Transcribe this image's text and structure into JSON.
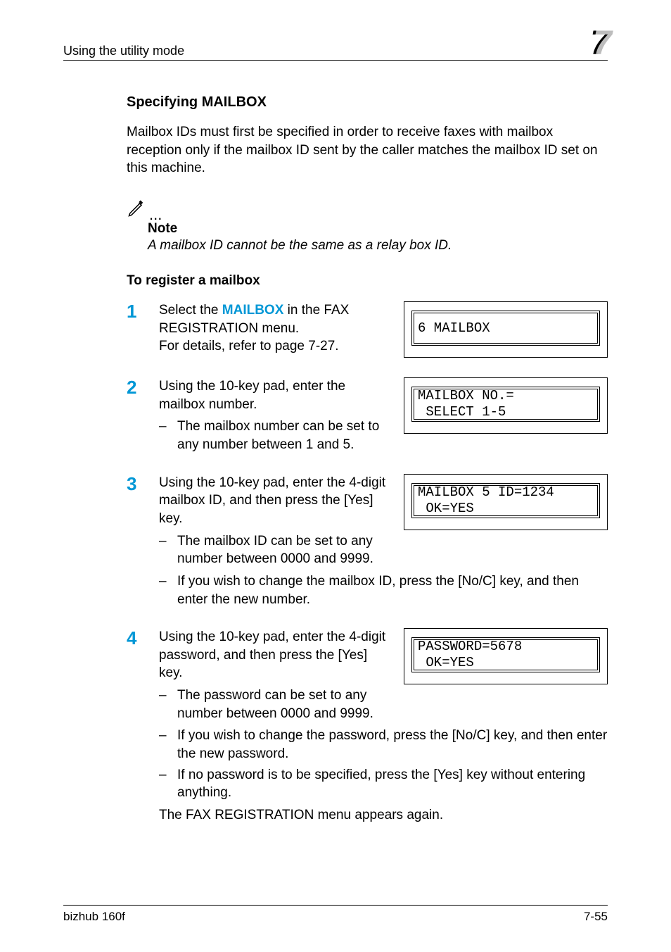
{
  "header": {
    "running": "Using the utility mode",
    "chapter": "7"
  },
  "title": "Specifying MAILBOX",
  "intro": "Mailbox IDs must first be specified in order to receive faxes with mailbox reception only if the mailbox ID sent by the caller matches the mailbox ID set on this machine.",
  "note": {
    "label": "Note",
    "body": "A mailbox ID cannot be the same as a relay box ID."
  },
  "subhead": "To register a mailbox",
  "steps": {
    "s1": {
      "num": "1",
      "t1": "Select the ",
      "term": "MAILBOX",
      "t2": " in the FAX REGISTRATION menu.",
      "t3": "For details, refer to page 7-27.",
      "lcd": "6 MAILBOX"
    },
    "s2": {
      "num": "2",
      "t": "Using the 10-key pad, enter the mailbox number.",
      "b1": "The mailbox number can be set to any number between 1 and 5.",
      "lcd1": "MAILBOX NO.=",
      "lcd2": " SELECT 1-5"
    },
    "s3": {
      "num": "3",
      "t": "Using the 10-key pad, enter the 4-digit mailbox ID, and then press the [Yes] key.",
      "b1": "The mailbox ID can be set to any number between 0000 and 9999.",
      "b2": "If you wish to change the mailbox ID, press the [No/C] key, and then enter the new number.",
      "lcd1": "MAILBOX 5 ID=1234",
      "lcd2": " OK=YES"
    },
    "s4": {
      "num": "4",
      "t": "Using the 10-key pad, enter the 4-digit password, and then press the [Yes] key.",
      "b1": "The password can be set to any number between 0000 and 9999.",
      "b2": "If you wish to change the password, press the [No/C] key, and then enter the new password.",
      "b3": "If no password is to be specified, press the [Yes] key without entering anything.",
      "outro": "The FAX REGISTRATION menu appears again.",
      "lcd1": "PASSWORD=5678",
      "lcd2": " OK=YES"
    }
  },
  "footer": {
    "left": "bizhub 160f",
    "right": "7-55"
  }
}
